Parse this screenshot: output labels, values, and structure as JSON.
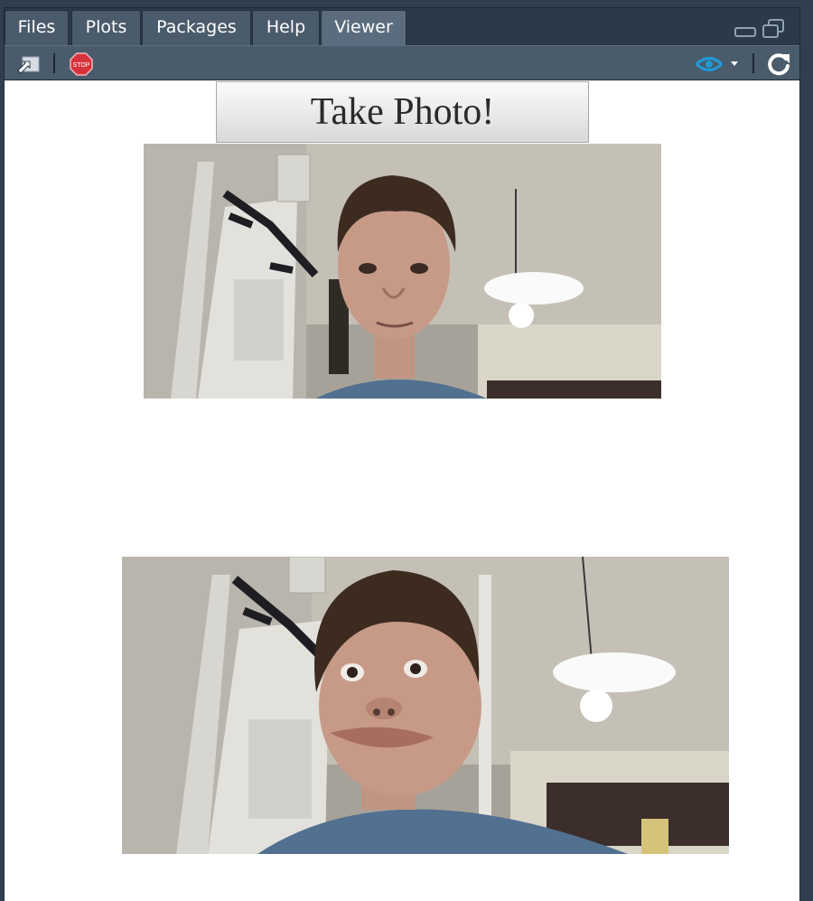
{
  "tabs": [
    {
      "label": "Files",
      "active": false
    },
    {
      "label": "Plots",
      "active": false
    },
    {
      "label": "Packages",
      "active": false
    },
    {
      "label": "Help",
      "active": false
    },
    {
      "label": "Viewer",
      "active": true
    }
  ],
  "toolbar": {
    "stop_icon_text": "STOP",
    "icons": [
      "export-icon",
      "stop-icon",
      "sync-viewer-icon",
      "dropdown-icon",
      "refresh-icon"
    ]
  },
  "viewer": {
    "button_label": "Take Photo!",
    "photos": [
      {
        "name": "live-webcam-feed",
        "subject": "webcam-person-neutral"
      },
      {
        "name": "captured-photo",
        "subject": "webcam-person-funny-face"
      }
    ]
  },
  "colors": {
    "tabbar_bg": "#2b3a48",
    "toolbar_bg": "#4a5b6b",
    "accent_blue": "#1e9bd7",
    "stop_red": "#d8333c",
    "shirt_blue": "#52708f"
  }
}
